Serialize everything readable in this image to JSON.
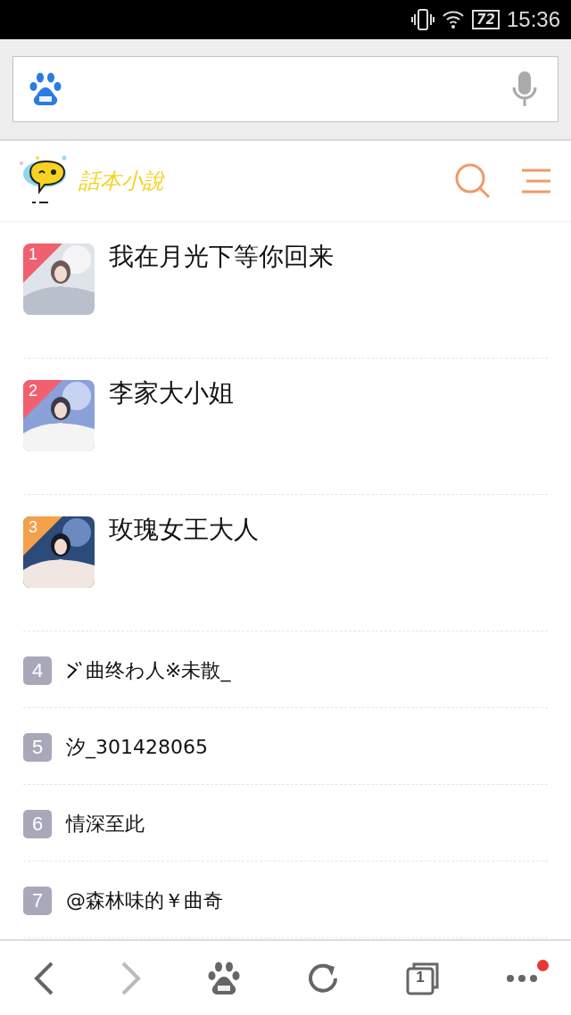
{
  "status_bar": {
    "battery": "72",
    "time": "15:36"
  },
  "site_header": {
    "logo_text": "話本小說"
  },
  "ranking": [
    {
      "kind": "featured",
      "rank": "1",
      "color": "#f0606e",
      "title": "我在月光下等你回来"
    },
    {
      "kind": "featured",
      "rank": "2",
      "color": "#f0606e",
      "title": "李家大小姐"
    },
    {
      "kind": "featured",
      "rank": "3",
      "color": "#f5a04a",
      "title": "玫瑰女王大人"
    },
    {
      "kind": "plain",
      "rank": "4",
      "color": "#a9a8bb",
      "leading_mark": true,
      "title": "曲终わ人※未散_"
    },
    {
      "kind": "plain",
      "rank": "5",
      "color": "#a9a8bb",
      "leading_mark": false,
      "title": "汐_301428065"
    },
    {
      "kind": "plain",
      "rank": "6",
      "color": "#a9a8bb",
      "leading_mark": false,
      "title": "情深至此"
    },
    {
      "kind": "plain",
      "rank": "7",
      "color": "#a9a8bb",
      "leading_mark": false,
      "title": "@森林味的￥曲奇"
    }
  ],
  "bottom_nav": {
    "tab_count": "1",
    "has_notification": true
  }
}
